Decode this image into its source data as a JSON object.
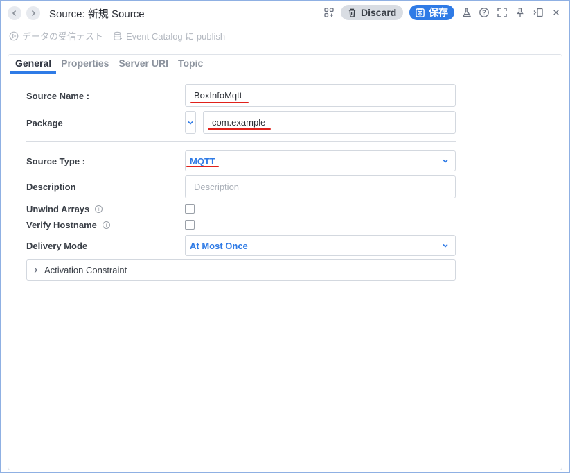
{
  "window": {
    "title": "Source: 新規 Source",
    "discard_label": "Discard",
    "save_label": "保存",
    "accent_color": "#2f7be6"
  },
  "toolbar": {
    "test_receive_label": "データの受信テスト",
    "publish_label": "Event Catalog に publish"
  },
  "tabs": [
    {
      "label": "General",
      "active": true
    },
    {
      "label": "Properties",
      "active": false
    },
    {
      "label": "Server URI",
      "active": false
    },
    {
      "label": "Topic",
      "active": false
    }
  ],
  "form": {
    "source_name": {
      "label": "Source Name :",
      "value": "BoxInfoMqtt"
    },
    "package": {
      "label": "Package",
      "value": "com.example"
    },
    "source_type": {
      "label": "Source Type :",
      "value": "MQTT"
    },
    "description": {
      "label": "Description",
      "placeholder": "Description"
    },
    "unwind_arrays": {
      "label": "Unwind Arrays",
      "checked": false
    },
    "verify_hostname": {
      "label": "Verify Hostname",
      "checked": false
    },
    "delivery_mode": {
      "label": "Delivery Mode",
      "value": "At Most Once"
    },
    "activation_constraint": {
      "label": "Activation Constraint",
      "expanded": false
    }
  },
  "icons": [
    "chevron-left-icon",
    "chevron-right-icon",
    "apps-add-icon",
    "trash-icon",
    "save-icon",
    "flask-icon",
    "help-icon",
    "fullscreen-icon",
    "pin-icon",
    "panel-icon",
    "close-icon",
    "play-circle-icon",
    "database-icon",
    "info-icon",
    "chevron-down-icon",
    "chevron-right-small-icon"
  ]
}
